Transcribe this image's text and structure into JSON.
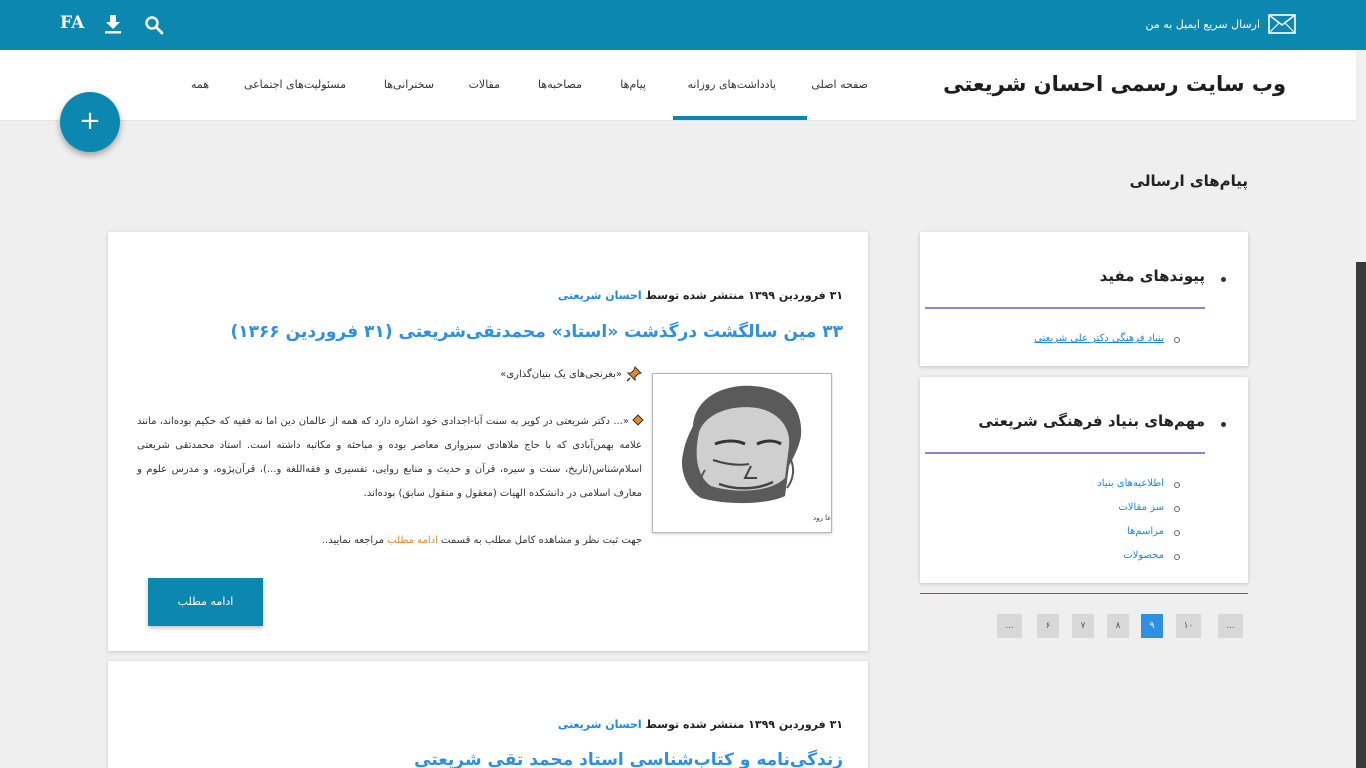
{
  "topbar": {
    "email_label": "ارسال سریع ایمیل به من",
    "lang_label": "FA",
    "icons": [
      "mail-icon",
      "download-icon",
      "search-icon"
    ]
  },
  "header": {
    "site_title": "وب سایت رسمی احسان شریعتی",
    "nav": [
      "صفحه اصلی",
      "یادداشت‌های روزانه",
      "پیام‌ها",
      "مصاحبه‌ها",
      "مقالات",
      "سخنرانی‌ها",
      "مسئولیت‌های اجتماعی",
      "همه"
    ],
    "active_nav": "یادداشت‌های روزانه"
  },
  "fab": {
    "label": "+"
  },
  "page": {
    "section_title": "پیام‌های ارسالی"
  },
  "posts": [
    {
      "date": "۳۱ فروردین ۱۳۹۹",
      "published_by": "منتشر شده توسط",
      "author": "احسان شریعتی",
      "title": "۳۳ مین سالگشت درگذشت «استاد» محمدتقی‌شریعتی (۳۱ فروردین ۱۳۶۶)",
      "subtitle": "«بغرنجی‌های یک بنیان‌گذاری»",
      "excerpt": "«... دکتر شریعتی در کویر به سنت آبا-اجدادی خود اشاره دارد که همه از عالمان دین اما نه فقیه که حکیم بوده‌اند، مانند علامه بهمن‌آبادی که با حاج ملاهادی سبزواری معاصر بوده و مباحثه و مکاتبه داشته است. استاد محمدتقی شریعتی اسلام‌شناس(تاریخ، سنت و سیره، قرآن و حدیث و منابع روایی، تفسیری و فقه‌اللغة و...)، قرآن‌پژوه، و مدرس علوم و معارف اسلامی در دانشکده الهیات (معقول و منقول سابق) بوده‌اند.",
      "cta_prefix": "جهت ثبت نظر و مشاهده کامل مطلب به قسمت",
      "cta_link": "ادامه مطلب",
      "cta_suffix": "مراجعه نمایید..",
      "image_caption": "هرکس به جهان آمد باید که بی‌ادعا رود",
      "read_more_label": "ادامه مطلب"
    },
    {
      "date": "۳۱ فروردین ۱۳۹۹",
      "published_by": "منتشر شده توسط",
      "author": "احسان شریعتی",
      "title": "زندگی‌نامه و کتاب‌شناسی استاد محمد تقی شریعتی"
    }
  ],
  "sidebar": {
    "widgets": [
      {
        "title": "پیوندهای مفید",
        "links": [
          "بنیاد فرهنگی دکتر علی شریعتی"
        ]
      },
      {
        "title": "مهم‌های بنیاد فرهنگی شریعتی",
        "links": [
          "اطلاعیه‌های بنیاد",
          "سر مقالات",
          "مراسم‌ها",
          "محصولات"
        ]
      }
    ]
  },
  "pagination": {
    "items": [
      "...",
      "۱۰",
      "۹",
      "۸",
      "۷",
      "۶",
      "..."
    ],
    "active": "۹"
  },
  "colors": {
    "brand": "#0c88b0",
    "link": "#2f8fe0",
    "accent": "#e08a2c",
    "rule": "#8e82d6"
  }
}
